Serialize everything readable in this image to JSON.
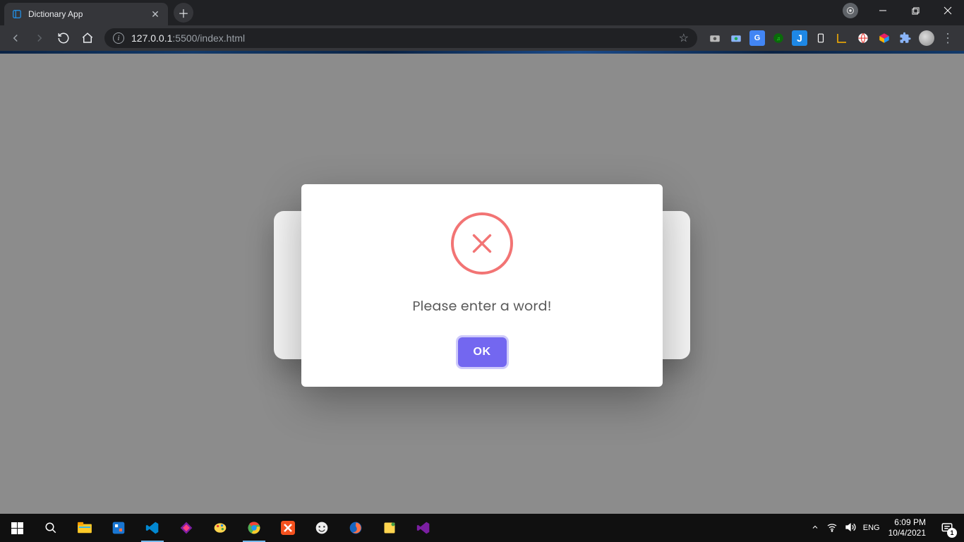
{
  "browser": {
    "tab": {
      "title": "Dictionary App"
    },
    "url_host": "127.0.0.1",
    "url_path": ":5500/index.html"
  },
  "modal": {
    "message": "Please enter a word!",
    "confirm_label": "OK"
  },
  "taskbar": {
    "time": "6:09 PM",
    "date": "10/4/2021",
    "notifications": "1"
  }
}
